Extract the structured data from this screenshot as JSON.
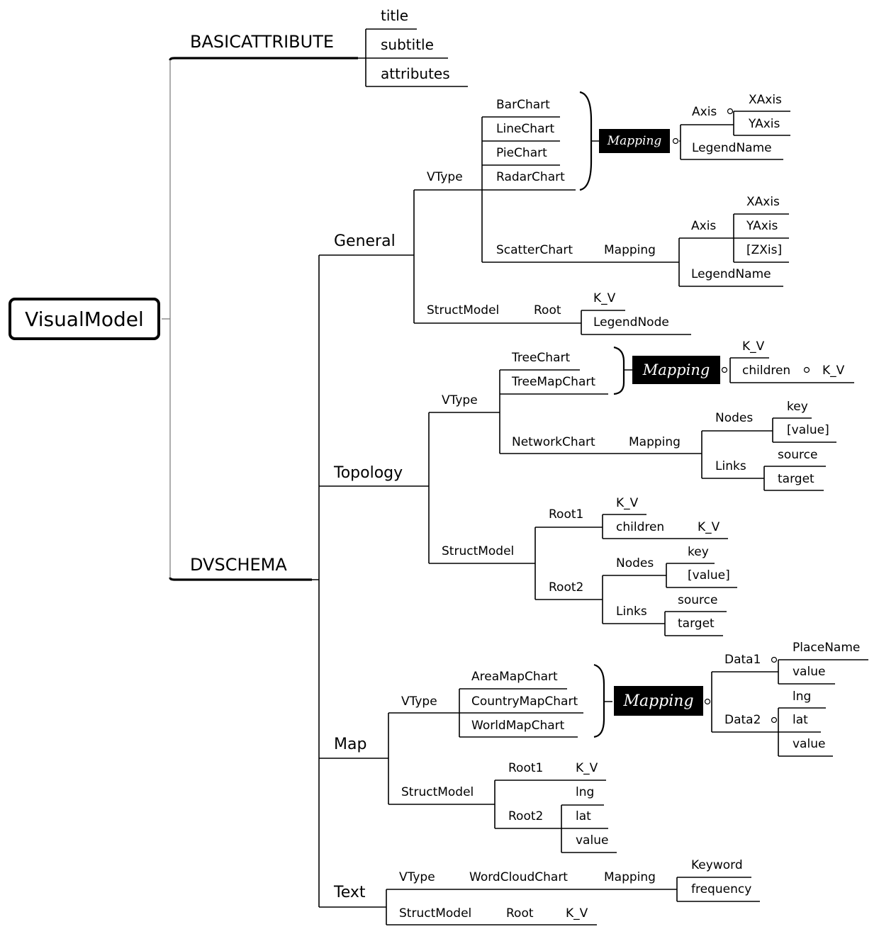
{
  "root": "VisualModel",
  "basic": {
    "label": "BASICATTRIBUTE",
    "items": [
      "title",
      "subtitle",
      "attributes"
    ]
  },
  "dvschema": {
    "label": "DVSCHEMA",
    "general": {
      "label": "General",
      "vtype": "VType",
      "charts": [
        "BarChart",
        "LineChart",
        "PieChart",
        "RadarChart"
      ],
      "mapping": "Mapping",
      "axis": "Axis",
      "axes": [
        "XAxis",
        "YAxis"
      ],
      "legend": "LegendName",
      "scatter": "ScatterChart",
      "scatter_mapping": "Mapping",
      "scatter_axis": "Axis",
      "scatter_axes": [
        "XAxis",
        "YAxis",
        "[ZXis]"
      ],
      "scatter_legend": "LegendName",
      "struct": "StructModel",
      "root": "Root",
      "kv": "K_V",
      "legend_node": "LegendNode"
    },
    "topology": {
      "label": "Topology",
      "vtype": "VType",
      "charts": [
        "TreeChart",
        "TreeMapChart"
      ],
      "mapping": "Mapping",
      "kv": "K_V",
      "children": "children",
      "children_kv": "K_V",
      "network": "NetworkChart",
      "network_mapping": "Mapping",
      "nodes": "Nodes",
      "node_fields": [
        "key",
        "[value]"
      ],
      "links": "Links",
      "link_fields": [
        "source",
        "target"
      ],
      "struct": "StructModel",
      "root1": "Root1",
      "root1_kv": "K_V",
      "root1_children": "children",
      "root1_children_kv": "K_V",
      "root2": "Root2",
      "root2_nodes": "Nodes",
      "root2_node_fields": [
        "key",
        "[value]"
      ],
      "root2_links": "Links",
      "root2_link_fields": [
        "source",
        "target"
      ]
    },
    "map": {
      "label": "Map",
      "vtype": "VType",
      "charts": [
        "AreaMapChart",
        "CountryMapChart",
        "WorldMapChart"
      ],
      "mapping": "Mapping",
      "data1": "Data1",
      "data1_fields": [
        "PlaceName",
        "value"
      ],
      "data2": "Data2",
      "data2_fields": [
        "lng",
        "lat",
        "value"
      ],
      "struct": "StructModel",
      "root1": "Root1",
      "root1_kv": "K_V",
      "root2": "Root2",
      "root2_fields": [
        "lng",
        "lat",
        "value"
      ]
    },
    "text": {
      "label": "Text",
      "vtype": "VType",
      "chart": "WordCloudChart",
      "mapping": "Mapping",
      "fields": [
        "Keyword",
        "frequency"
      ],
      "struct": "StructModel",
      "root": "Root",
      "kv": "K_V"
    }
  }
}
